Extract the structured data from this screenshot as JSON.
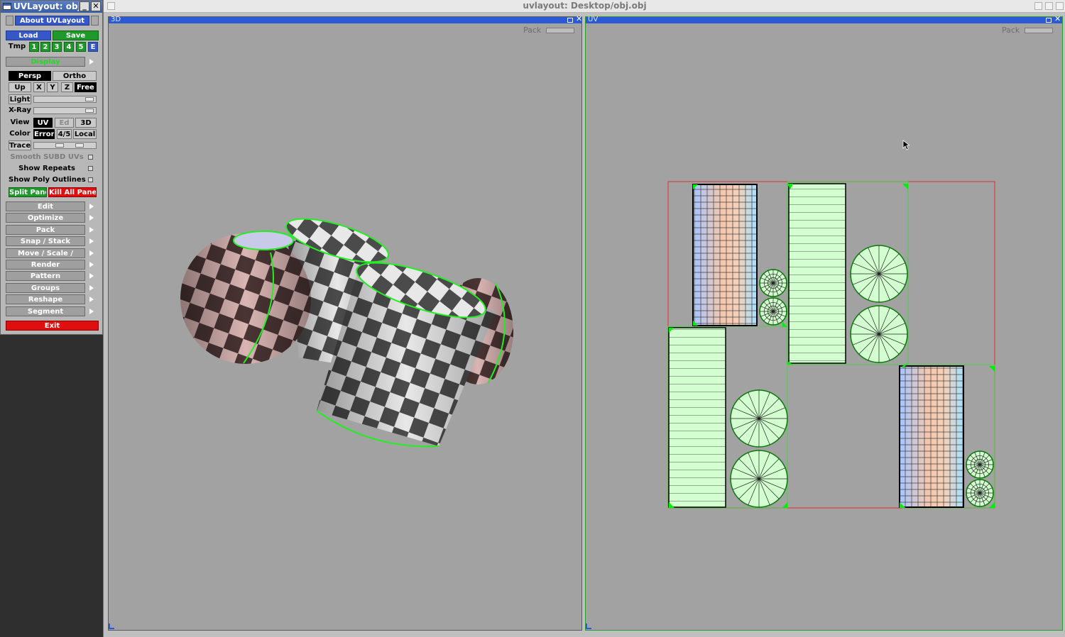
{
  "panel": {
    "title": "UVLayout: obj.obj",
    "about": "About UVLayout",
    "load": "Load",
    "save": "Save",
    "tmp_label": "Tmp",
    "tmp_slots": [
      "1",
      "2",
      "3",
      "4",
      "5",
      "E"
    ],
    "display": "Display",
    "persp": "Persp",
    "ortho": "Ortho",
    "up_label": "Up",
    "axes": [
      "X",
      "Y",
      "Z",
      "Free"
    ],
    "light": "Light",
    "xray": "X-Ray",
    "view_label": "View",
    "view_modes": [
      "UV",
      "Ed",
      "3D"
    ],
    "color_label": "Color",
    "color_modes": [
      "Error",
      "4/5",
      "Local"
    ],
    "trace": "Trace",
    "smooth_subd": "Smooth SUBD UVs",
    "show_repeats": "Show Repeats",
    "show_poly_outlines": "Show Poly Outlines",
    "split_pane": "Split Pane",
    "kill_all_panes": "Kill All Panes",
    "menus": [
      "Edit",
      "Optimize",
      "Pack",
      "Snap / Stack",
      "Move / Scale / Rotate",
      "Render",
      "Pattern",
      "Groups",
      "Reshape",
      "Segment"
    ],
    "exit": "Exit"
  },
  "main": {
    "title": "uvlayout: Desktop/obj.obj",
    "pane3d": {
      "label": "3D",
      "pack": "Pack"
    },
    "paneuv": {
      "label": "UV",
      "pack": "Pack"
    }
  },
  "icons": {
    "window": "window-icon",
    "minimize": "minimize-icon",
    "maximize": "maximize-icon",
    "close": "close-icon",
    "submenu": "chevron-right-icon",
    "cursor": "mouse-cursor-icon"
  },
  "colors": {
    "accent_blue": "#2c5ad6",
    "button_green": "#1f9a2a",
    "button_red": "#e00f0f",
    "uv_shell_green": "#d3ffd0",
    "uv_outline_green": "#00dd00",
    "pack_bounds_red": "#e03030",
    "viewport_gray": "#a2a2a2"
  }
}
